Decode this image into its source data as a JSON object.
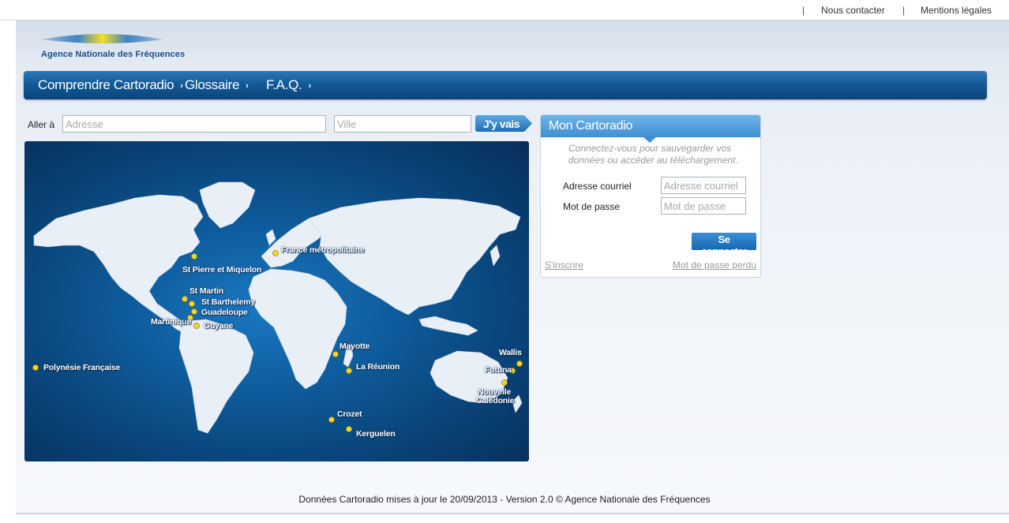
{
  "topbar": {
    "separator": "|",
    "contact": "Nous contacter",
    "legal": "Mentions légales"
  },
  "logo": {
    "name": "Agence Nationale des Fréquences"
  },
  "nav": {
    "items": [
      {
        "label": "Comprendre Cartoradio"
      },
      {
        "label": "Glossaire"
      },
      {
        "label": "F.A.Q."
      }
    ],
    "chevron": "›"
  },
  "search": {
    "label": "Aller à",
    "address_placeholder": "Adresse",
    "city_placeholder": "Ville",
    "go_label": "J'y vais"
  },
  "map": {
    "locations": [
      {
        "name": "France métropolitaine"
      },
      {
        "name": "St Pierre et Miquelon"
      },
      {
        "name": "St Martin"
      },
      {
        "name": "St Barthelemy"
      },
      {
        "name": "Guadeloupe"
      },
      {
        "name": "Martinique"
      },
      {
        "name": "Guyane"
      },
      {
        "name": "Polynésie Française"
      },
      {
        "name": "Mayotte"
      },
      {
        "name": "La Réunion"
      },
      {
        "name": "Crozet"
      },
      {
        "name": "Kerguelen"
      },
      {
        "name": "Wallis"
      },
      {
        "name": "Futuna"
      },
      {
        "name": "Nouvelle"
      },
      {
        "name": "Calédonie"
      }
    ]
  },
  "login": {
    "title": "Mon Cartoradio",
    "hint": "Connectez-vous pour sauvegarder vos données ou accéder au téléchargement.",
    "email_label": "Adresse courriel",
    "email_placeholder": "Adresse courriel",
    "password_label": "Mot de passe",
    "password_placeholder": "Mot de passe",
    "connect_label": "Se connecter",
    "register_link": "S'inscrire",
    "forgot_link": "Mot de passe perdu"
  },
  "footer": {
    "text": "Données Cartoradio mises à jour le 20/09/2013 - Version 2.0 © Agence Nationale des Fréquences"
  },
  "colors": {
    "nav": "#135a98",
    "map_ocean": "#0f5e9f",
    "land": "#e8eef6",
    "marker": "#e8c417",
    "button": "#1e6fb6"
  }
}
